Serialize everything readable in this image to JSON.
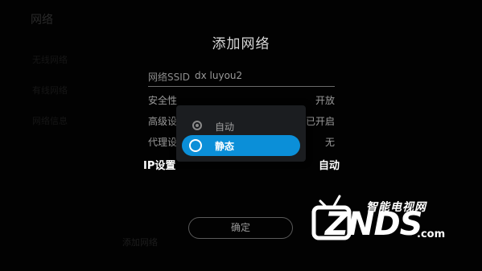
{
  "background": {
    "title": "网络",
    "items": [
      {
        "label": "无线网络"
      },
      {
        "label": "有线网络"
      },
      {
        "label": "网络信息"
      }
    ],
    "hint": "添加网络"
  },
  "dialog": {
    "title": "添加网络",
    "ssid": {
      "label": "网络SSID",
      "value": "dx luyou2"
    },
    "security": {
      "label": "安全性",
      "value": "开放"
    },
    "advanced": {
      "label": "高级设",
      "value": "已开启"
    },
    "proxy": {
      "label": "代理设",
      "value": "无"
    },
    "ip": {
      "label": "IP设置",
      "value": "自动"
    },
    "confirm_label": "确定"
  },
  "popup": {
    "options": [
      {
        "label": "自动",
        "selected": true,
        "focused": false
      },
      {
        "label": "静态",
        "selected": false,
        "focused": true
      }
    ],
    "accent": "#0b8fd8"
  },
  "watermark": {
    "top_text": "智能电视网",
    "main_text": "ZNDS",
    "suffix": ".com"
  }
}
